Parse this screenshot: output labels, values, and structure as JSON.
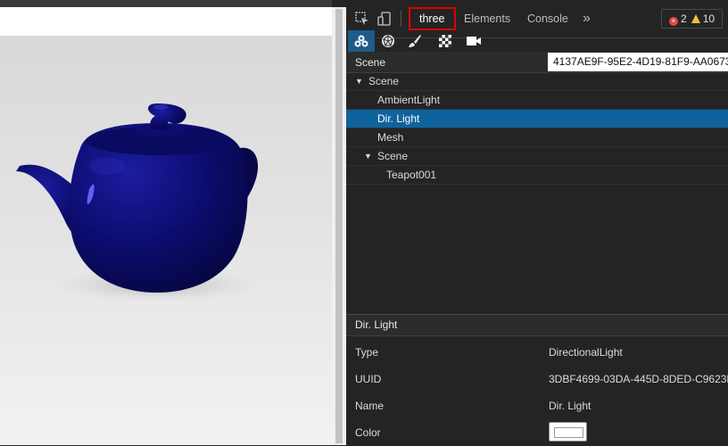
{
  "tabs": [
    {
      "label": "three",
      "active": true
    },
    {
      "label": "Elements",
      "active": false
    },
    {
      "label": "Console",
      "active": false
    }
  ],
  "toolbar": {
    "more_label": "»",
    "errors": "2",
    "warnings": "10",
    "icons": [
      "inspect-element-icon",
      "device-toggle-icon",
      "scene-icon",
      "geometry-icon",
      "material-icon",
      "texture-icon",
      "camera-icon"
    ]
  },
  "scene_bar": {
    "label": "Scene",
    "uuid": "4137AE9F-95E2-4D19-81F9-AA06734"
  },
  "tree": [
    {
      "label": "Scene",
      "level": 0,
      "expanded": true,
      "selected": false
    },
    {
      "label": "AmbientLight",
      "level": 1,
      "selected": false
    },
    {
      "label": "Dir. Light",
      "level": 1,
      "selected": true
    },
    {
      "label": "Mesh",
      "level": 1,
      "selected": false
    },
    {
      "label": "Scene",
      "level": 1,
      "expanded": true,
      "selected": false
    },
    {
      "label": "Teapot001",
      "level": 2,
      "selected": false
    }
  ],
  "properties": {
    "header": "Dir. Light",
    "rows": [
      {
        "key": "Type",
        "value": "DirectionalLight"
      },
      {
        "key": "UUID",
        "value": "3DBF4699-03DA-445D-8DED-C9623B"
      },
      {
        "key": "Name",
        "value": "Dir. Light"
      },
      {
        "key": "Color",
        "value": "",
        "swatch": "#ffffff"
      }
    ]
  },
  "colors": {
    "panel_bg": "#242424",
    "selection": "#0e639c",
    "active_tab_outline": "#e00000",
    "teapot": "#0a0a5a"
  }
}
